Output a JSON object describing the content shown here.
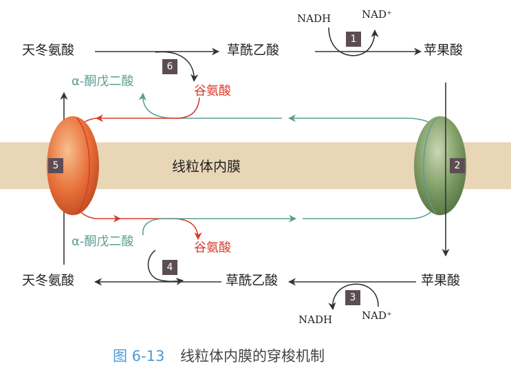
{
  "membrane": {
    "label": "线粒体内膜"
  },
  "top": {
    "aspartate": "天冬氨酸",
    "oxaloacetate": "草酰乙酸",
    "malate": "苹果酸",
    "alpha_ketoglutarate": "α-酮戊二酸",
    "glutamate": "谷氨酸",
    "nadh": "NADH",
    "nad_plus": "NAD⁺"
  },
  "bottom": {
    "aspartate": "天冬氨酸",
    "oxaloacetate": "草酰乙酸",
    "malate": "苹果酸",
    "alpha_ketoglutarate": "α-酮戊二酸",
    "glutamate": "谷氨酸",
    "nadh": "NADH",
    "nad_plus": "NAD⁺"
  },
  "badges": {
    "b1": "1",
    "b2": "2",
    "b3": "3",
    "b4": "4",
    "b5": "5",
    "b6": "6"
  },
  "caption": {
    "figure_no": "图 6-13",
    "title": "线粒体内膜的穿梭机制"
  },
  "colors": {
    "membrane_band": "#e8d6b6",
    "arrow_black": "#333333",
    "arrow_red": "#d83a2a",
    "arrow_teal": "#5a9e92",
    "badge_bg": "#5c4d55",
    "caption_figno": "#4a9ad8",
    "caption_title": "#444444"
  }
}
